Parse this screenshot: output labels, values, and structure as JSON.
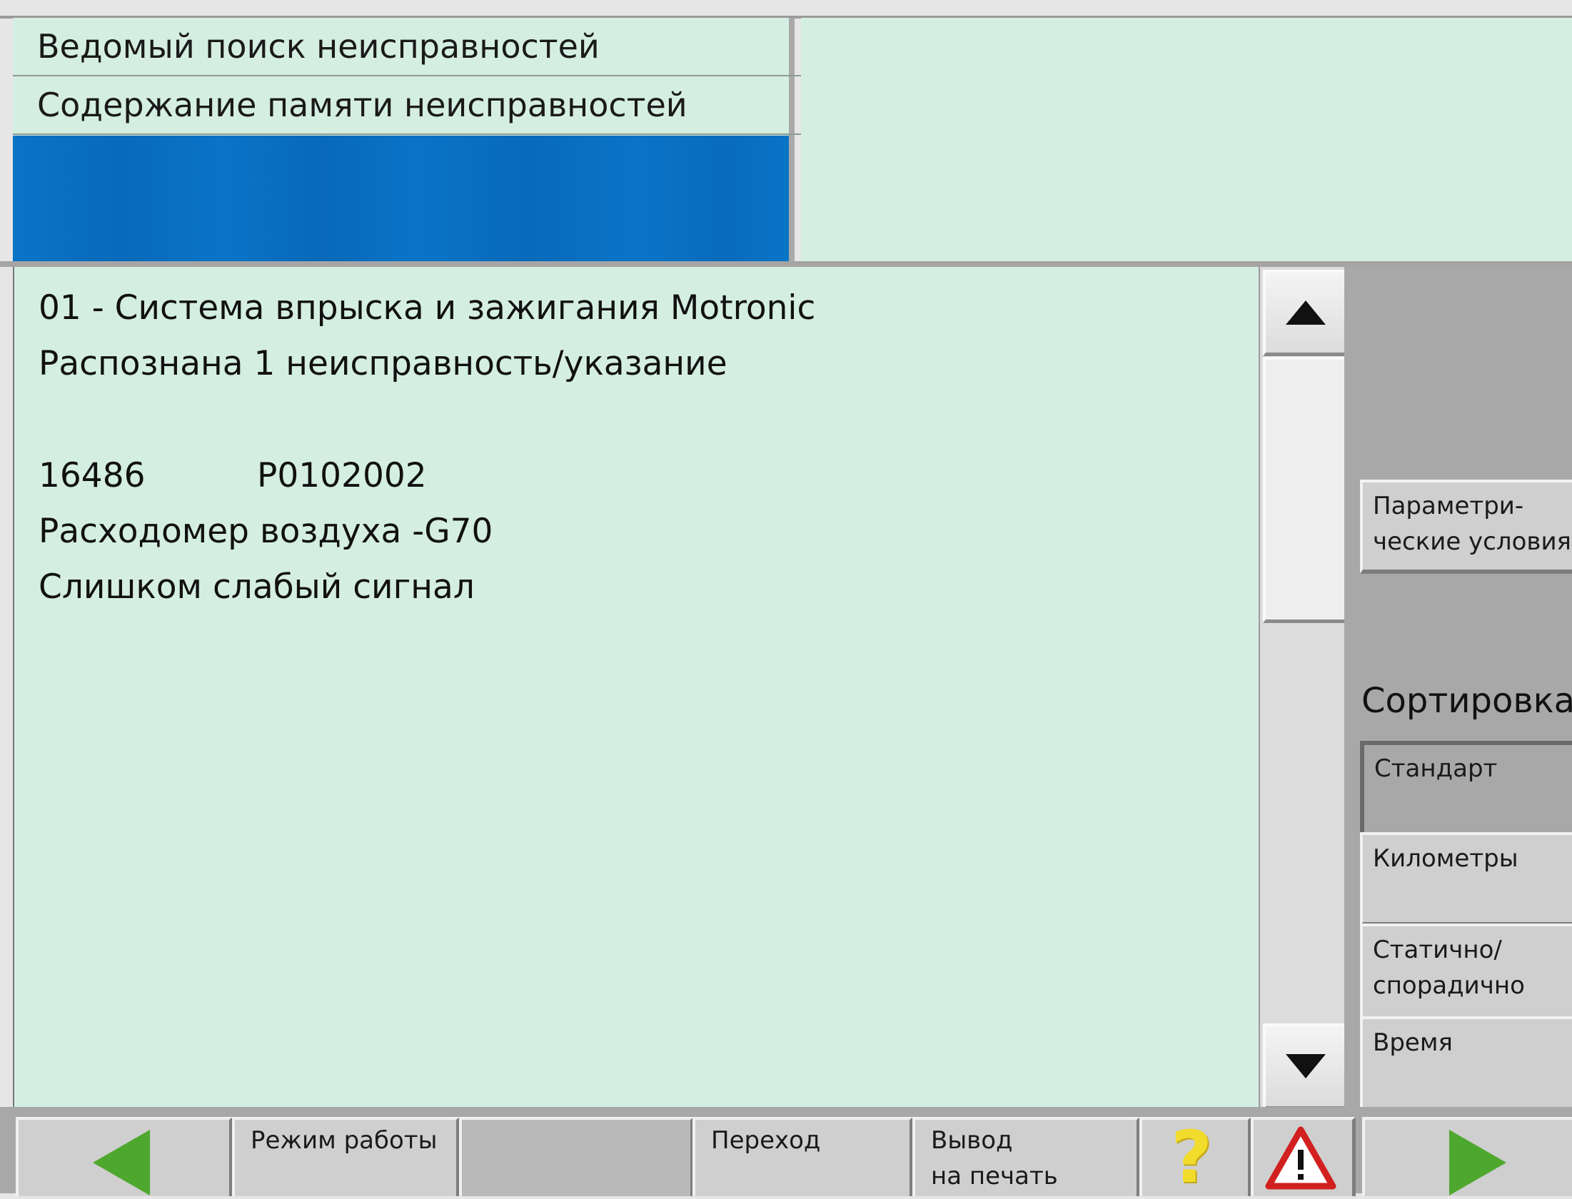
{
  "header": {
    "row1": "Ведомый поиск неисправностей",
    "row2": "Содержание памяти неисправностей"
  },
  "content": {
    "system": "01 - Система впрыска и зажигания Motronic",
    "status": "Распознана 1 неисправность/указание",
    "fault_code": "16486",
    "fault_pcode": "P0102002",
    "fault_component": "Расходомер воздуха -G70",
    "fault_description": "Слишком слабый сигнал"
  },
  "side": {
    "params_line1": "Параметри-",
    "params_line2": "ческие условия",
    "sort_label": "Сортировка",
    "standard": "Стандарт",
    "km": "Километры",
    "static_line1": "Статично/",
    "static_line2": "спорадично",
    "time": "Время"
  },
  "toolbar": {
    "mode": "Режим работы",
    "goto": "Переход",
    "print_line1": "Вывод",
    "print_line2": "на печать",
    "help_symbol": "?"
  },
  "icons": {
    "back": "arrow-left-icon",
    "next": "arrow-right-icon",
    "help": "question-mark-icon",
    "warning": "warning-triangle-icon",
    "scroll_up": "triangle-up-icon",
    "scroll_down": "triangle-down-icon"
  },
  "colors": {
    "panel_bg": "#d5eee2",
    "header_blue": "#0a74c6",
    "arrow_green": "#4ea82e",
    "help_yellow": "#f1dc2c",
    "warning_red": "#d21f1f"
  }
}
